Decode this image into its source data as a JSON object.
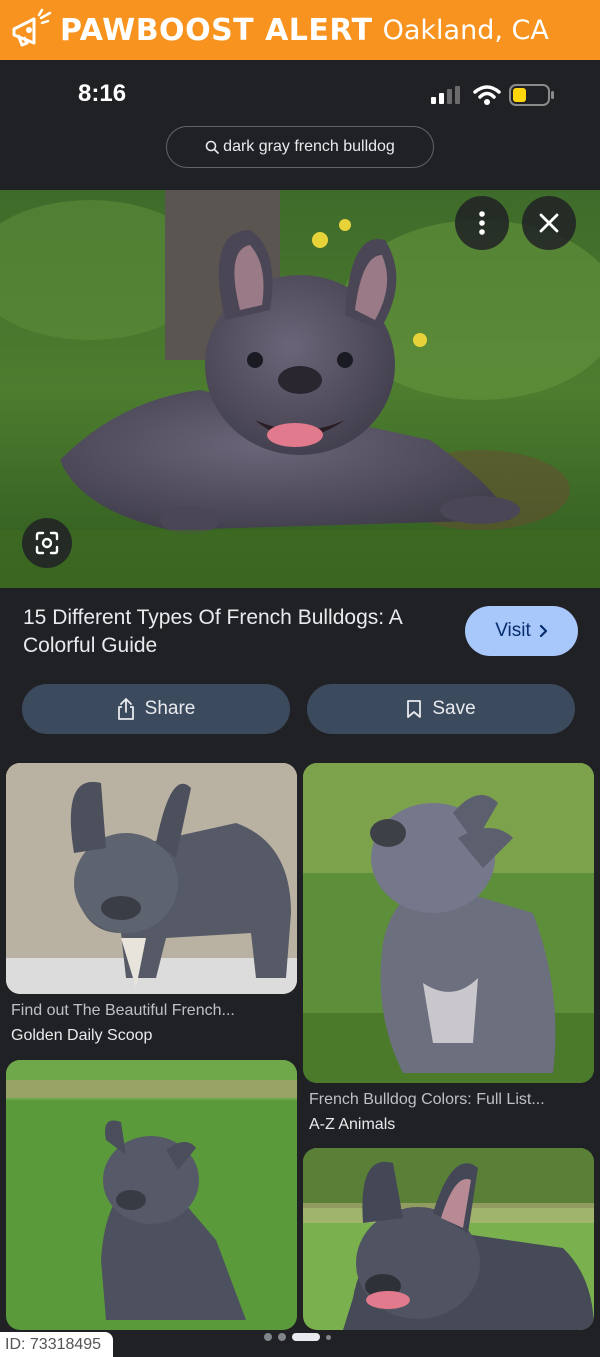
{
  "banner": {
    "brand": "PAWBOOST ALERT",
    "city": "Oakland, CA",
    "icon": "megaphone-icon"
  },
  "status_bar": {
    "time": "8:16"
  },
  "search": {
    "query": "dark gray french bulldog"
  },
  "result": {
    "title": "15 Different Types Of French Bulldogs: A Colorful Guide",
    "visit_label": "Visit"
  },
  "actions": {
    "share_label": "Share",
    "save_label": "Save"
  },
  "related": [
    {
      "title": "Find out The Beautiful French...",
      "source": "Golden Daily Scoop"
    },
    {
      "title": "French Bulldog Colors: Full List...",
      "source": "A-Z Animals"
    },
    {
      "title": "",
      "source": ""
    },
    {
      "title": "",
      "source": ""
    }
  ],
  "footer": {
    "id_label": "ID: 73318495"
  },
  "colors": {
    "banner": "#f7931e",
    "background": "#202124",
    "visit": "#a8c7fa",
    "action": "#3c4a5e"
  }
}
